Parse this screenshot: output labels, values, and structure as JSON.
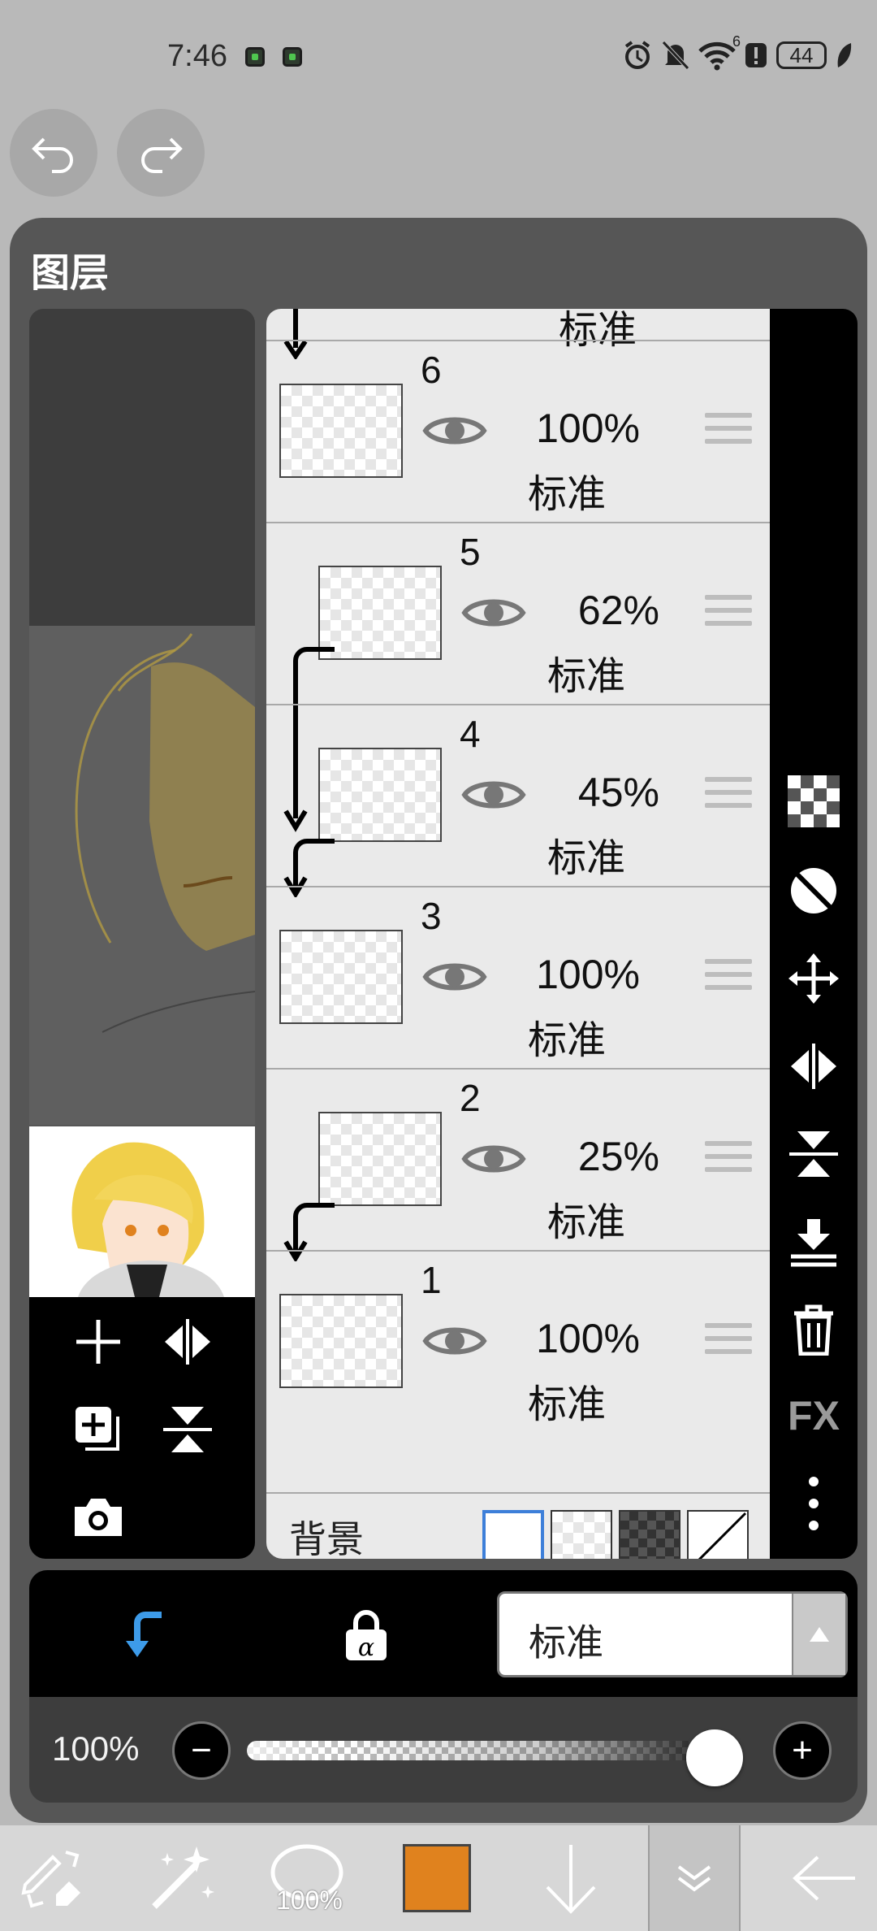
{
  "status_bar": {
    "time": "7:46",
    "battery": "44",
    "signal_badge": "6"
  },
  "history": {
    "undo_icon": "undo-arrow",
    "redo_icon": "redo-arrow"
  },
  "panel": {
    "title": "图层"
  },
  "layers": [
    {
      "number": "",
      "opacity": "",
      "mode": "标准",
      "visible": true,
      "clipped": true
    },
    {
      "number": "6",
      "opacity": "100%",
      "mode": "标准",
      "visible": true,
      "clipped": false
    },
    {
      "number": "5",
      "opacity": "62%",
      "mode": "标准",
      "visible": true,
      "clipped": true
    },
    {
      "number": "4",
      "opacity": "45%",
      "mode": "标准",
      "visible": true,
      "clipped": true
    },
    {
      "number": "3",
      "opacity": "100%",
      "mode": "标准",
      "visible": true,
      "clipped": false
    },
    {
      "number": "2",
      "opacity": "25%",
      "mode": "标准",
      "visible": true,
      "clipped": true
    },
    {
      "number": "1",
      "opacity": "100%",
      "mode": "标准",
      "visible": true,
      "clipped": false
    }
  ],
  "background": {
    "label": "背景",
    "options": [
      "white",
      "transparent",
      "dark-checker",
      "none"
    ],
    "selected": "white"
  },
  "right_tools": [
    "checker-icon",
    "circle-half-icon",
    "move-icon",
    "flip-horizontal-icon",
    "flip-vertical-icon",
    "merge-down-icon",
    "trash-icon",
    "fx-label",
    "more-icon"
  ],
  "right_tools_fx_label": "FX",
  "mode_bar": {
    "blend_mode": "标准",
    "clip_active_color": "#3d9be9"
  },
  "opacity_bar": {
    "value": "100%",
    "level": 1.0,
    "minus": "−",
    "plus": "+"
  },
  "bottom_bar": {
    "brush_size": "100%",
    "color": "#e0821e"
  },
  "colors": {
    "accent": "#3d9be9",
    "panel": "#565656",
    "list_bg": "#eaeaea",
    "current_color": "#e0821e"
  }
}
